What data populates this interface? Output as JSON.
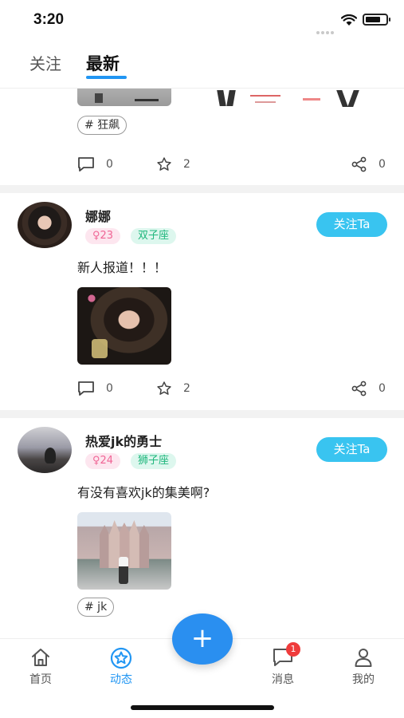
{
  "status_bar": {
    "time": "3:20"
  },
  "tabs": [
    {
      "label": "关注",
      "active": false
    },
    {
      "label": "最新",
      "active": true
    }
  ],
  "accent_color": "#2196f3",
  "feed": {
    "partial_post": {
      "tag": "# 狂飙",
      "comments": "0",
      "stars": "2",
      "shares": "0"
    },
    "posts": [
      {
        "username": "娜娜",
        "gender_age": "♀23",
        "zodiac": "双子座",
        "follow_label": "关注Ta",
        "content": "新人报道！！！",
        "comments": "0",
        "stars": "2",
        "shares": "0"
      },
      {
        "username": "热爱jk的勇士",
        "gender_age": "♀24",
        "zodiac": "狮子座",
        "follow_label": "关注Ta",
        "content": "有没有喜欢jk的集美啊?",
        "tag": "# jk"
      }
    ]
  },
  "fab": {
    "label": "+"
  },
  "bottom_nav": [
    {
      "label": "首页",
      "icon": "home-icon"
    },
    {
      "label": "动态",
      "icon": "star-circle-icon",
      "active": true
    },
    {
      "label": "消息",
      "icon": "message-icon",
      "badge": "1"
    },
    {
      "label": "我的",
      "icon": "user-icon"
    }
  ]
}
